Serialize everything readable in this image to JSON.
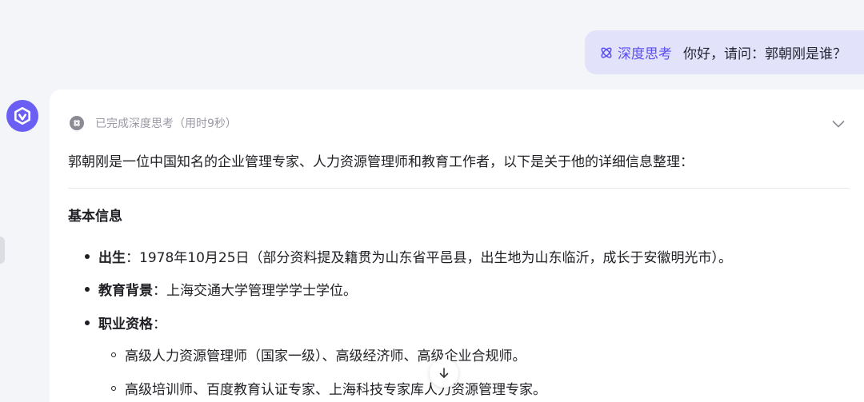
{
  "user_message": {
    "tag_label": "深度思考",
    "text": "你好，请问：郭朝刚是谁？",
    "tag_color": "#5b4ff0",
    "bubble_color": "#e2e2fb"
  },
  "assistant": {
    "avatar_color": "#6a5ff2",
    "status": "已完成深度思考（用时9秒）",
    "intro": "郭朝刚是一位中国知名的企业管理专家、人力资源管理师和教育工作者，以下是关于他的详细信息整理：",
    "section_title": "基本信息",
    "bullets": [
      {
        "label": "出生",
        "sep": "：",
        "text": "1978年10月25日（部分资料提及籍贯为山东省平邑县，出生地为山东临沂，成长于安徽明光市）。"
      },
      {
        "label": "教育背景",
        "sep": "：",
        "text": "上海交通大学管理学学士学位。"
      },
      {
        "label": "职业资格",
        "sep": "：",
        "text": ""
      }
    ],
    "sub_bullets": [
      "高级人力资源管理师（国家一级）、高级经济师、高级企业合规师。",
      "高级培训师、百度教育认证专家、上海科技专家库人力资源管理专家。"
    ]
  },
  "icons": {
    "think": "atom-icon",
    "avatar": "assistant-logo-icon",
    "status": "deep-think-icon",
    "collapse": "chevron-down-icon",
    "scroll": "arrow-down-icon"
  }
}
